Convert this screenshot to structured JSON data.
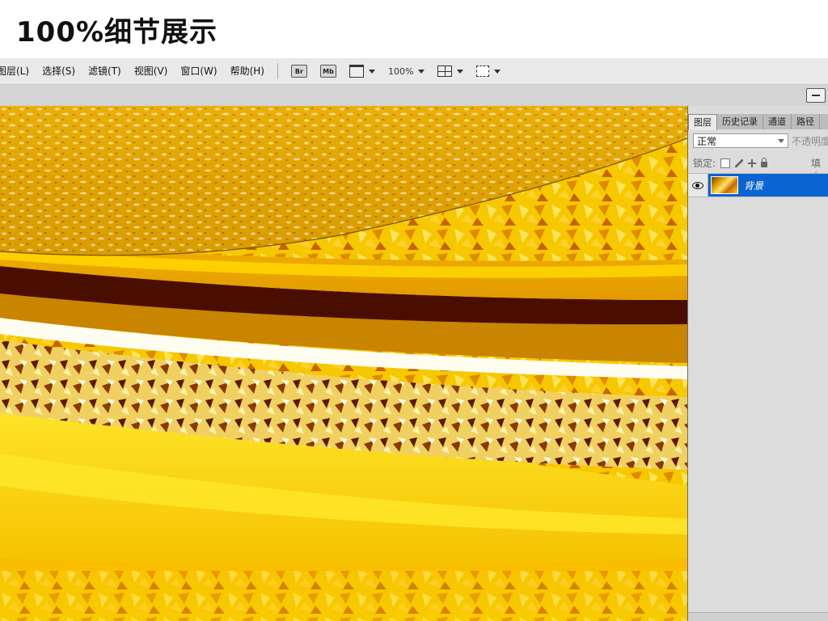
{
  "banner": {
    "title": "100%细节展示"
  },
  "menubar": {
    "items": [
      "图层(L)",
      "选择(S)",
      "滤镜(T)",
      "视图(V)",
      "窗口(W)",
      "帮助(H)"
    ],
    "bridge_button": "Br",
    "minibridge_button": "Mb",
    "zoom_value": "100%"
  },
  "layers_panel": {
    "tabs": [
      "图层",
      "历史记录",
      "通道",
      "路径"
    ],
    "active_tab": "图层",
    "blend_mode": "正常",
    "opacity_label": "不透明度",
    "lock_label": "锁定:",
    "fill_label": "填充",
    "layers": [
      {
        "name": "背景",
        "visible": true,
        "selected": true
      }
    ]
  },
  "colors": {
    "selection_blue": "#0a64d2",
    "canvas_gold": "#f3a000",
    "dark_stripe": "#4a0e00"
  }
}
